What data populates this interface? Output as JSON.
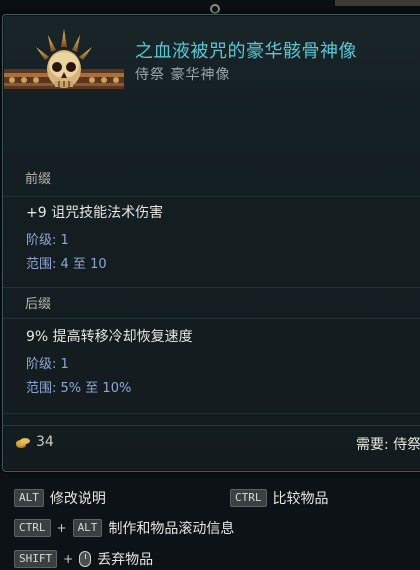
{
  "item": {
    "title": "之血液被咒的豪华骸骨神像",
    "subtitle": "侍祭 豪华神像"
  },
  "prefix": {
    "label": "前缀",
    "stat": "+9 诅咒技能法术伤害",
    "tier_label": "阶级:",
    "tier_value": "1",
    "range_label": "范围:",
    "range_value": "4 至 10"
  },
  "suffix": {
    "label": "后缀",
    "stat": "9% 提高转移冷却恢复速度",
    "tier_label": "阶级:",
    "tier_value": "1",
    "range_label": "范围:",
    "range_value": "5% 至 10%"
  },
  "footer": {
    "coin_icon": "gold-coin-icon",
    "coin_value": "34",
    "requirement": "需要: 侍祭"
  },
  "hints": {
    "alt_key": "ALT",
    "alt_label": "修改说明",
    "ctrl_key": "CTRL",
    "ctrl_label": "比较物品",
    "ctrl2_key": "CTRL",
    "alt2_key": "ALT",
    "combo_label": "制作和物品滚动信息",
    "shift_key": "SHIFT",
    "shift_label": "丢弃物品",
    "plus": "+"
  },
  "colors": {
    "title": "#57c7d6",
    "range": "#8fa7d8",
    "border": "#3d5a5c"
  }
}
